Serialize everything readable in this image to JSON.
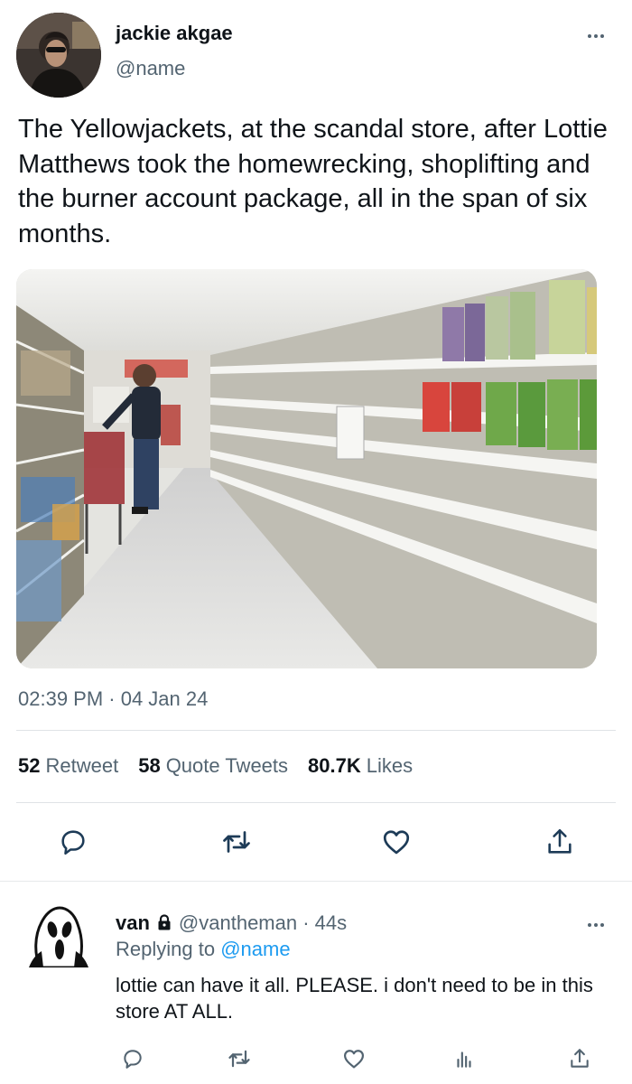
{
  "tweet": {
    "author_name": "jackie akgae",
    "author_handle": "@name",
    "text": "The Yellowjackets, at the scandal store, after Lottie Matthews took the homewrecking, shoplifting and the burner account package, all in the span of six months.",
    "timestamp": "02:39 PM · 04 Jan 24",
    "media_icon": "photo",
    "stats": {
      "retweets_count": "52",
      "retweets_label": "Retweet",
      "quotes_count": "58",
      "quotes_label": "Quote Tweets",
      "likes_count": "80.7K",
      "likes_label": "Likes"
    },
    "actions": [
      "reply-icon",
      "retweet-icon",
      "like-icon",
      "share-icon"
    ]
  },
  "reply": {
    "author_name": "van",
    "author_handle": "@vantheman",
    "time": "· 44s",
    "replying_prefix": "Replying to",
    "replying_to": "@name",
    "text": "lottie can have it all. PLEASE. i don't need to be in this store AT ALL.",
    "actions": [
      "reply-icon",
      "retweet-icon",
      "like-icon",
      "analytics-icon",
      "share-icon"
    ]
  },
  "colors": {
    "text": "#0f1419",
    "secondary": "#536471",
    "accent": "#1d9bf0",
    "divider": "#dfe3e6"
  }
}
